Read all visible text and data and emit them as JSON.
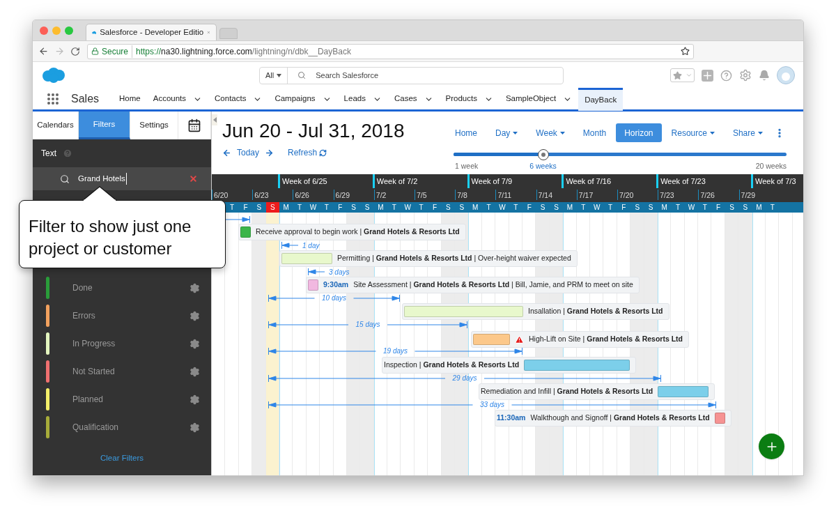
{
  "browser": {
    "tab_title": "Salesforce - Developer Editio",
    "secure": "Secure",
    "url": {
      "scheme": "https://",
      "host": "na30.lightning.force.com",
      "path": "/lightning/n/dbk__DayBack"
    }
  },
  "salesforce": {
    "search_scope": "All",
    "search_placeholder": "Search Salesforce",
    "app_name": "Sales",
    "nav": [
      {
        "label": "Home",
        "dropdown": false,
        "selected": false
      },
      {
        "label": "Accounts",
        "dropdown": true,
        "selected": false
      },
      {
        "label": "Contacts",
        "dropdown": true,
        "selected": false
      },
      {
        "label": "Campaigns",
        "dropdown": true,
        "selected": false
      },
      {
        "label": "Leads",
        "dropdown": true,
        "selected": false
      },
      {
        "label": "Cases",
        "dropdown": true,
        "selected": false
      },
      {
        "label": "Products",
        "dropdown": true,
        "selected": false
      },
      {
        "label": "SampleObject",
        "dropdown": true,
        "selected": false
      },
      {
        "label": "DayBack",
        "dropdown": false,
        "selected": true
      }
    ]
  },
  "sidebar": {
    "tabs": [
      {
        "kind": "text",
        "label": "Calendars",
        "selected": false
      },
      {
        "kind": "text",
        "label": "Filters",
        "selected": true
      },
      {
        "kind": "text",
        "label": "Settings",
        "selected": false
      },
      {
        "kind": "icon",
        "selected": false
      }
    ],
    "text_filter": {
      "label": "Text",
      "value": "Grand Hotels"
    },
    "statuses": [
      {
        "label": "Done",
        "color": "#2a9d3a"
      },
      {
        "label": "Errors",
        "color": "#f2a15e"
      },
      {
        "label": "In Progress",
        "color": "#e3f5bf"
      },
      {
        "label": "Not Started",
        "color": "#f07070"
      },
      {
        "label": "Planned",
        "color": "#f4ef6a"
      },
      {
        "label": "Qualification",
        "color": "#a7ac3a"
      }
    ],
    "clear_filters": "Clear Filters"
  },
  "callout": "Filter to show just one project or customer",
  "calendar": {
    "title": "Jun 20 - Jul 31, 2018",
    "today": "Today",
    "refresh": "Refresh",
    "views": [
      {
        "label": "Home",
        "dropdown": false,
        "selected": false
      },
      {
        "label": "Day",
        "dropdown": true,
        "selected": false
      },
      {
        "label": "Week",
        "dropdown": true,
        "selected": false
      },
      {
        "label": "Month",
        "dropdown": false,
        "selected": false
      },
      {
        "label": "Horizon",
        "dropdown": false,
        "selected": true
      },
      {
        "label": "Resource",
        "dropdown": true,
        "selected": false
      },
      {
        "label": "Share",
        "dropdown": true,
        "selected": false
      }
    ],
    "horizon": {
      "level": 0.27,
      "min": "1 week",
      "value": "6 weeks",
      "max": "20 weeks"
    },
    "weeks": [
      "Week of 6/25",
      "Week of 7/2",
      "Week of 7/9",
      "Week of 7/16",
      "Week of 7/23",
      "Week of 7/3"
    ],
    "date_ticks": [
      "6/20",
      "6/23",
      "6/26",
      "6/29",
      "7/2",
      "7/5",
      "7/8",
      "7/11",
      "7/14",
      "7/17",
      "7/20",
      "7/23",
      "7/26",
      "7/29"
    ],
    "days": [
      {
        "letter": "T",
        "weekend": false,
        "today": false
      },
      {
        "letter": "F",
        "weekend": false,
        "today": false
      },
      {
        "letter": "S",
        "weekend": true,
        "today": false
      },
      {
        "letter": "S",
        "weekend": true,
        "today": true
      },
      {
        "letter": "M",
        "weekend": false,
        "today": false
      },
      {
        "letter": "T",
        "weekend": false,
        "today": false
      },
      {
        "letter": "W",
        "weekend": false,
        "today": false
      },
      {
        "letter": "T",
        "weekend": false,
        "today": false
      },
      {
        "letter": "F",
        "weekend": false,
        "today": false
      },
      {
        "letter": "S",
        "weekend": true,
        "today": false
      },
      {
        "letter": "S",
        "weekend": true,
        "today": false
      },
      {
        "letter": "M",
        "weekend": false,
        "today": false
      },
      {
        "letter": "T",
        "weekend": false,
        "today": false
      },
      {
        "letter": "W",
        "weekend": false,
        "today": false
      },
      {
        "letter": "T",
        "weekend": false,
        "today": false
      },
      {
        "letter": "F",
        "weekend": false,
        "today": false
      },
      {
        "letter": "S",
        "weekend": true,
        "today": false
      },
      {
        "letter": "S",
        "weekend": true,
        "today": false
      },
      {
        "letter": "M",
        "weekend": false,
        "today": false
      },
      {
        "letter": "T",
        "weekend": false,
        "today": false
      },
      {
        "letter": "W",
        "weekend": false,
        "today": false
      },
      {
        "letter": "T",
        "weekend": false,
        "today": false
      },
      {
        "letter": "F",
        "weekend": false,
        "today": false
      },
      {
        "letter": "S",
        "weekend": true,
        "today": false
      },
      {
        "letter": "S",
        "weekend": true,
        "today": false
      },
      {
        "letter": "M",
        "weekend": false,
        "today": false
      },
      {
        "letter": "T",
        "weekend": false,
        "today": false
      },
      {
        "letter": "W",
        "weekend": false,
        "today": false
      },
      {
        "letter": "T",
        "weekend": false,
        "today": false
      },
      {
        "letter": "F",
        "weekend": false,
        "today": false
      },
      {
        "letter": "S",
        "weekend": true,
        "today": false
      },
      {
        "letter": "S",
        "weekend": true,
        "today": false
      },
      {
        "letter": "M",
        "weekend": false,
        "today": false
      },
      {
        "letter": "T",
        "weekend": false,
        "today": false
      },
      {
        "letter": "W",
        "weekend": false,
        "today": false
      },
      {
        "letter": "T",
        "weekend": false,
        "today": false
      },
      {
        "letter": "F",
        "weekend": false,
        "today": false
      },
      {
        "letter": "S",
        "weekend": true,
        "today": false
      },
      {
        "letter": "S",
        "weekend": true,
        "today": false
      },
      {
        "letter": "M",
        "weekend": false,
        "today": false
      },
      {
        "letter": "T",
        "weekend": false,
        "today": false
      }
    ],
    "events": [
      {
        "text": "Receive approval to begin work | **Grand Hotels & Resorts Ltd**",
        "color": "#3bb54a",
        "warning": false
      },
      {
        "text": "Permitting | **Grand Hotels & Resorts Ltd** | Over-height waiver expected",
        "color": "#e8f8cc",
        "warning": false
      },
      {
        "time": "9:30am",
        "text": "Site Assessment | **Grand Hotels & Resorts Ltd** | Bill, Jamie, and PRM to meet on site",
        "color": "#f1b8e0",
        "warning": false
      },
      {
        "text": "Insallation | **Grand Hotels & Resorts Ltd**",
        "color": "#e8f8cc",
        "warning": false
      },
      {
        "text": "High-Lift on Site | **Grand Hotels & Resorts Ltd**",
        "color": "#fcc88a",
        "warning": true
      },
      {
        "text": "Inspection | **Grand Hotels & Resorts Ltd**",
        "color": "#7ccfea",
        "warning": false
      },
      {
        "text": "Remediation and Infill | **Grand Hotels & Resorts Ltd**",
        "color": "#7ccfea",
        "warning": false
      },
      {
        "time": "11:30am",
        "text": "Walkthough and Signoff | **Grand Hotels & Resorts Ltd**",
        "color": "#f69393",
        "warning": false
      }
    ],
    "durations": [
      {
        "label": "1 day"
      },
      {
        "label": "3 days"
      },
      {
        "label": "10 days"
      },
      {
        "label": "15 days"
      },
      {
        "label": "19 days"
      },
      {
        "label": "29 days"
      },
      {
        "label": "33 days"
      }
    ]
  }
}
